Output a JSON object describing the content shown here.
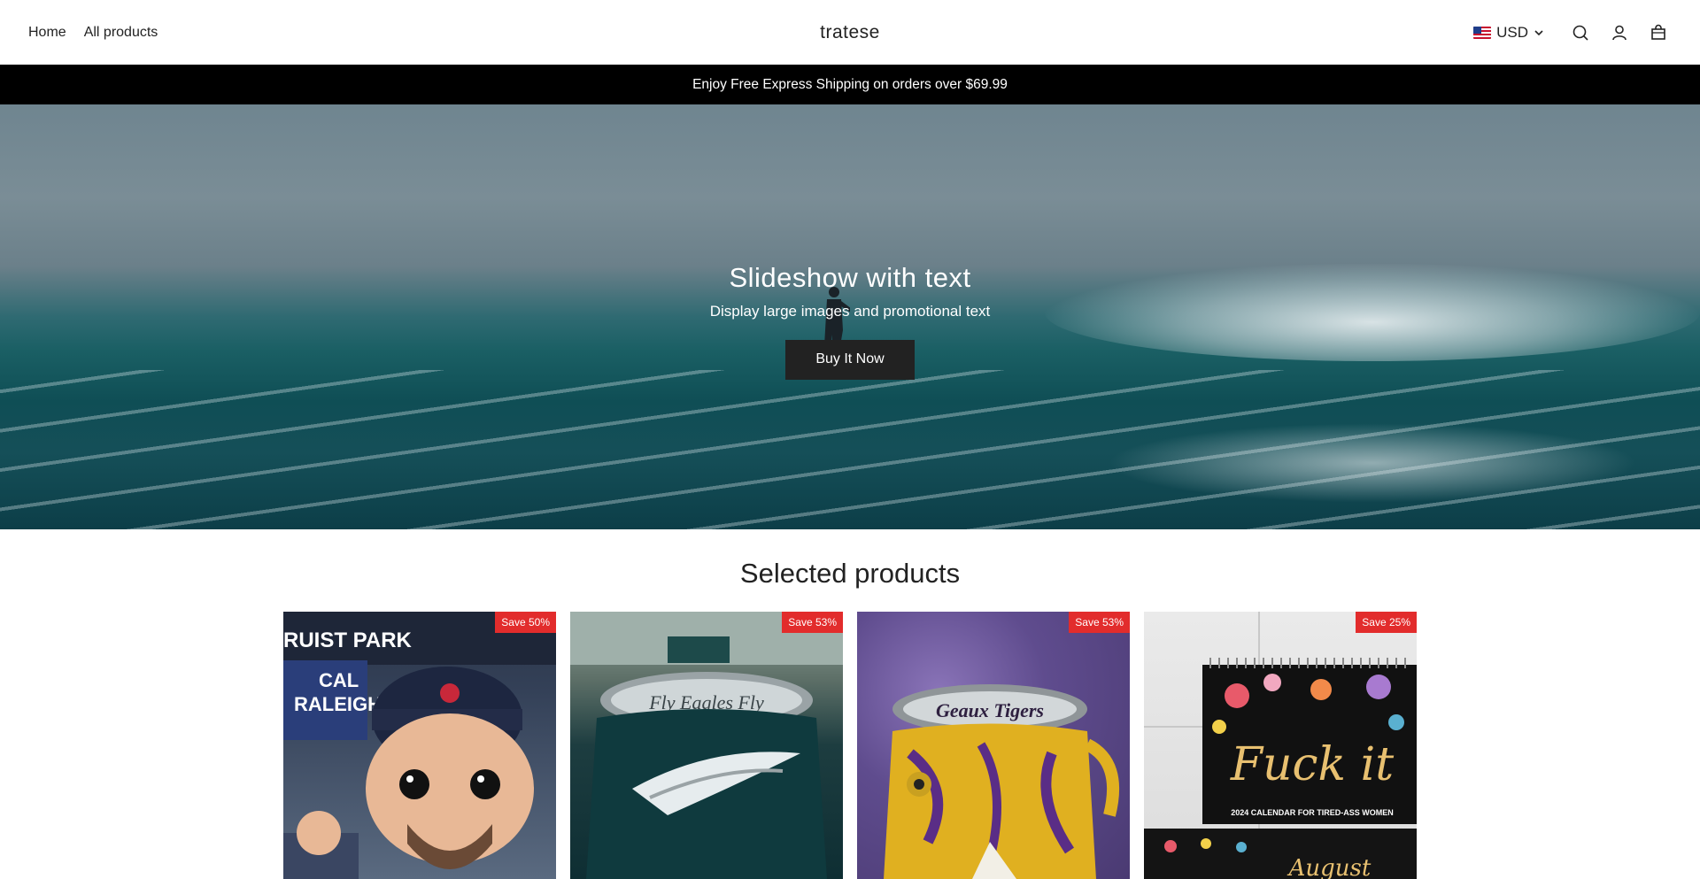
{
  "header": {
    "nav": [
      {
        "label": "Home"
      },
      {
        "label": "All products"
      }
    ],
    "brand": "tratese",
    "currency": "USD",
    "icons": [
      "search-icon",
      "account-icon",
      "cart-icon"
    ]
  },
  "announcement": "Enjoy Free Express Shipping on orders over $69.99",
  "hero": {
    "title": "Slideshow with text",
    "subtitle": "Display large images and promotional text",
    "button": "Buy It Now"
  },
  "products_section": {
    "title": "Selected products",
    "items": [
      {
        "badge": "Save 50%",
        "image_text": [
          "RUIST PARK",
          "CAL",
          "RALEIGH"
        ]
      },
      {
        "badge": "Save 53%",
        "image_text": [
          "Fly Eagles Fly"
        ]
      },
      {
        "badge": "Save 53%",
        "image_text": [
          "Geaux Tigers"
        ]
      },
      {
        "badge": "Save 25%",
        "image_text": [
          "Fuck it",
          "2024 CALENDAR FOR TIRED-ASS WOMEN",
          "August"
        ]
      }
    ]
  },
  "colors": {
    "announcement_bg": "#000000",
    "badge_bg": "#e22c2c",
    "button_bg": "#222222"
  }
}
